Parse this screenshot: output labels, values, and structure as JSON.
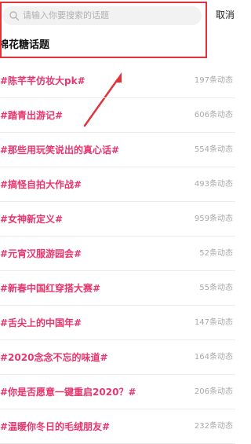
{
  "search": {
    "placeholder": "请输入你要搜索的话题",
    "cancel_label": "取消"
  },
  "section": {
    "title": "棉花糖话题"
  },
  "topics": [
    {
      "name": "#陈芊芊仿妆大pk#",
      "count": "197条动态"
    },
    {
      "name": "#踏青出游记#",
      "count": "606条动态"
    },
    {
      "name": "#那些用玩笑说出的真心话#",
      "count": "554条动态"
    },
    {
      "name": "#搞怪自拍大作战#",
      "count": "493条动态"
    },
    {
      "name": "#女神新定义#",
      "count": "959条动态"
    },
    {
      "name": "#元宵汉服游园会#",
      "count": "52条动态"
    },
    {
      "name": "#新春中国红穿搭大赛#",
      "count": "55条动态"
    },
    {
      "name": "#舌尖上的中国年#",
      "count": "147条动态"
    },
    {
      "name": "#2020念念不忘的味道#",
      "count": "164条动态"
    },
    {
      "name": "#你是否愿意一键重启2020？#",
      "count": "206条动态"
    },
    {
      "name": "#温暖你冬日的毛绒朋友#",
      "count": "232条动态"
    }
  ],
  "colors": {
    "topic_accent": "#e8356d",
    "annotation_red": "#e2323a",
    "count_gray": "#a8a8a8"
  },
  "icons": {
    "search": "search-icon"
  }
}
